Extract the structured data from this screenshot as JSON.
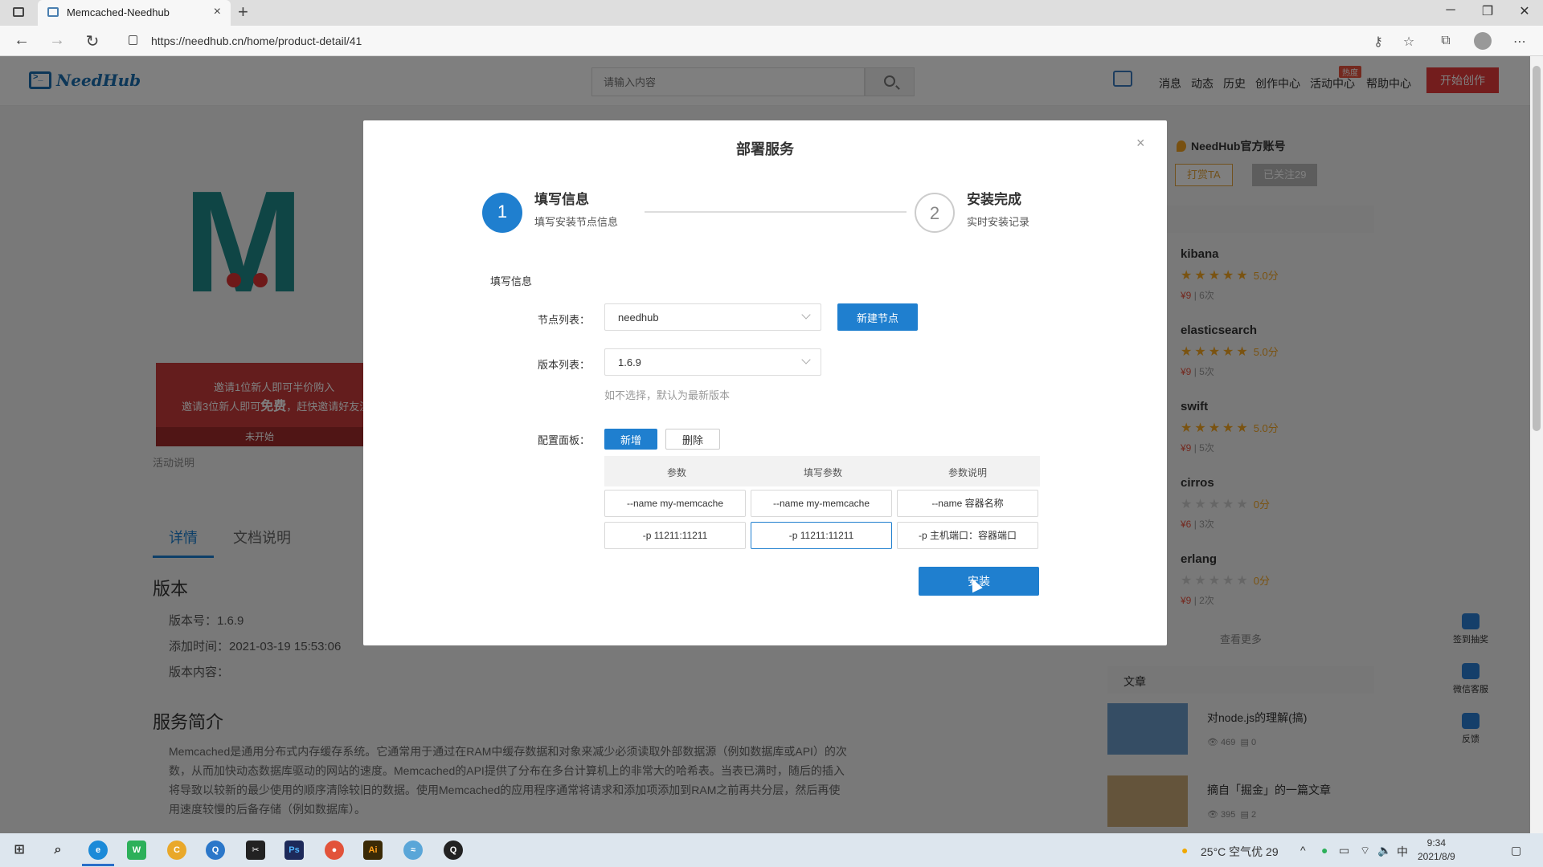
{
  "browser": {
    "tab_title": "Memcached-Needhub",
    "url": "https://needhub.cn/home/product-detail/41"
  },
  "header": {
    "logo_text": "NeedHub",
    "search_placeholder": "请输入内容",
    "nav": [
      "消息",
      "动态",
      "历史",
      "创作中心",
      "活动中心",
      "帮助中心"
    ],
    "hot_badge": "热度",
    "create_button": "开始创作"
  },
  "product": {
    "promo_line1": "邀请1位新人即可半价购入",
    "promo_line2_prefix": "邀请3位新人即可",
    "promo_line2_bold": "免费",
    "promo_line2_suffix": "，赶快邀请好友注册",
    "promo_status": "未开始",
    "activity_note": "活动说明",
    "tabs": [
      "详情",
      "文档说明"
    ],
    "version_heading": "版本",
    "version_number": "版本号：1.6.9",
    "added_time": "添加时间：2021-03-19 15:53:06",
    "version_content": "版本内容：",
    "intro_heading": "服务简介",
    "intro_text": "Memcached是通用分布式内存缓存系统。它通常用于通过在RAM中缓存数据和对象来减少必须读取外部数据源（例如数据库或API）的次数，从而加快动态数据库驱动的网站的速度。Memcached的API提供了分布在多台计算机上的非常大的哈希表。当表已满时，随后的插入将导致以较新的最少使用的顺序清除较旧的数据。使用Memcached的应用程序通常将请求和添加项添加到RAM之前再共分层，然后再使用速度较慢的后备存储（例如数据库）。"
  },
  "sidebar": {
    "official_account": "NeedHub官方账号",
    "tip_button": "打赏TA",
    "follow_button": "已关注29",
    "recommendations": [
      {
        "name": "kibana",
        "score": "5.0分",
        "price": "¥9",
        "count": "6次",
        "rated": true
      },
      {
        "name": "elasticsearch",
        "score": "5.0分",
        "price": "¥9",
        "count": "5次",
        "rated": true
      },
      {
        "name": "swift",
        "score": "5.0分",
        "price": "¥9",
        "count": "5次",
        "rated": true
      },
      {
        "name": "cirros",
        "score": "0分",
        "price": "¥6",
        "count": "3次",
        "rated": false
      },
      {
        "name": "erlang",
        "score": "0分",
        "price": "¥9",
        "count": "2次",
        "rated": false
      }
    ],
    "view_more": "查看更多",
    "articles_heading": "文章",
    "articles": [
      {
        "title": "对node.js的理解(搞)",
        "views": "469",
        "comments": "0"
      },
      {
        "title": "摘自「掘金」的一篇文章",
        "views": "395",
        "comments": "2"
      }
    ],
    "floaters": [
      "签到抽奖",
      "微信客服",
      "反馈"
    ]
  },
  "modal": {
    "title": "部署服务",
    "close": "×",
    "steps": [
      {
        "number": "1",
        "title": "填写信息",
        "desc": "填写安装节点信息"
      },
      {
        "number": "2",
        "title": "安装完成",
        "desc": "实时安装记录"
      }
    ],
    "section_label": "填写信息",
    "node_label": "节点列表：",
    "node_value": "needhub",
    "new_node_button": "新建节点",
    "version_label": "版本列表：",
    "version_value": "1.6.9",
    "version_hint": "如不选择，默认为最新版本",
    "config_label": "配置面板：",
    "add_button": "新增",
    "delete_button": "删除",
    "table_headers": [
      "参数",
      "填写参数",
      "参数说明"
    ],
    "rows": [
      [
        "--name my-memcache",
        "--name my-memcache",
        "--name 容器名称"
      ],
      [
        "-p 11211:11211",
        "-p 11211:11211",
        "-p 主机端口：容器端口"
      ]
    ],
    "install_button": "安装"
  },
  "taskbar": {
    "weather": "25°C 空气优 29",
    "time": "9:34",
    "date": "2021/8/9"
  }
}
